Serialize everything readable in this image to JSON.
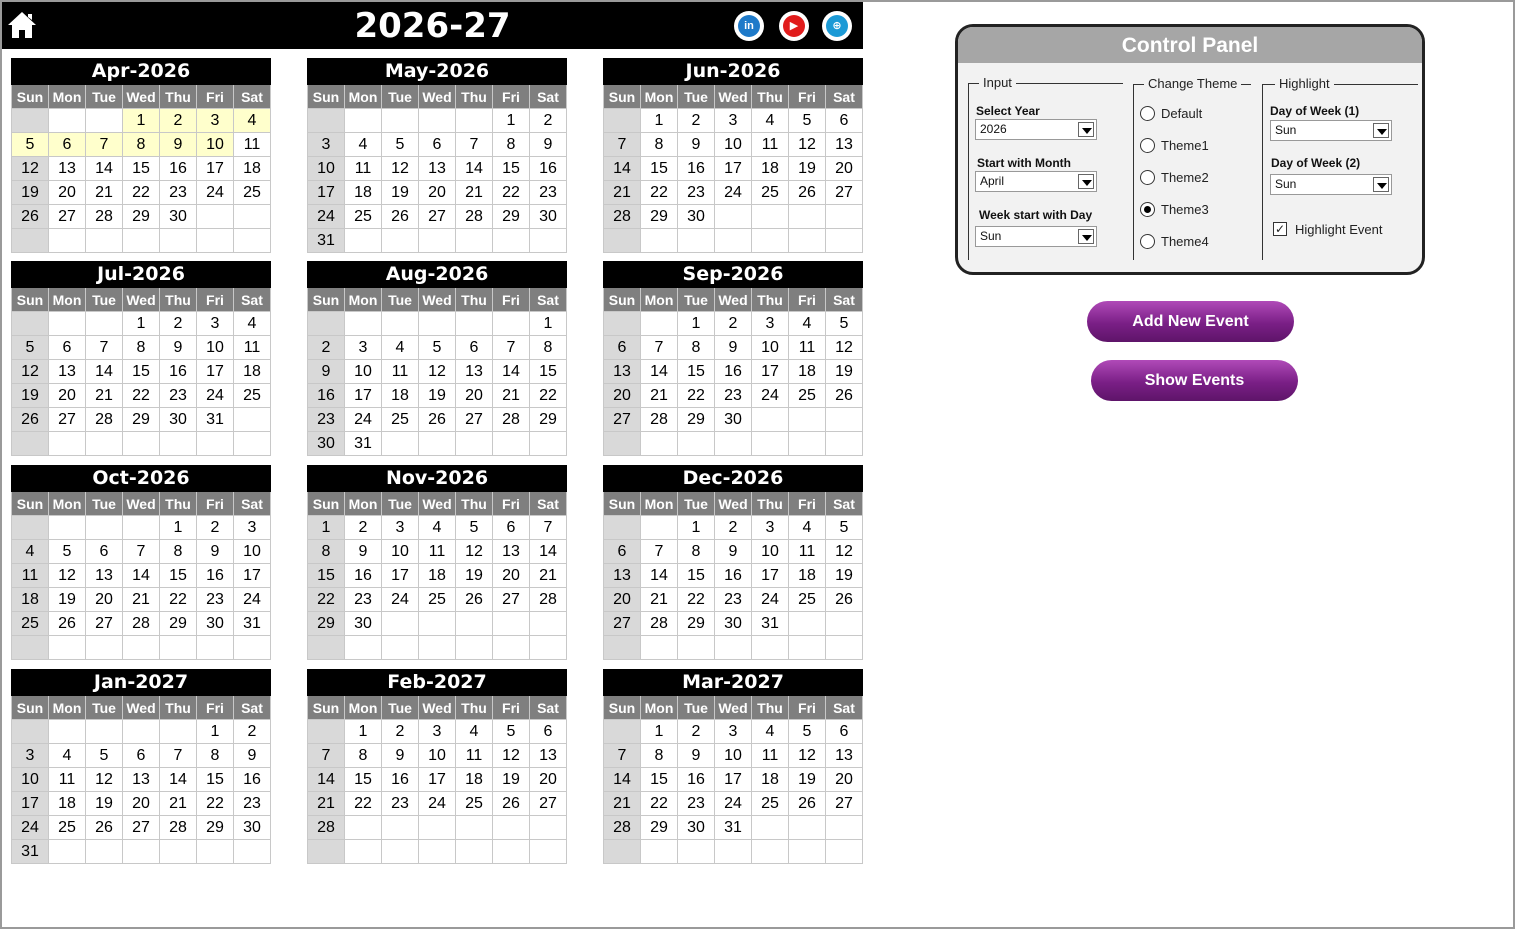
{
  "header": {
    "title": "2026-27",
    "social": [
      {
        "icon": "linkedin-icon",
        "glyph": "in",
        "color": "#1e7ac9"
      },
      {
        "icon": "youtube-icon",
        "glyph": "▶",
        "color": "#e11c1c"
      },
      {
        "icon": "globe-icon",
        "glyph": "⊕",
        "color": "#1c9ad6"
      }
    ]
  },
  "weekdays": [
    "Sun",
    "Mon",
    "Tue",
    "Wed",
    "Thu",
    "Fri",
    "Sat"
  ],
  "months": [
    {
      "title": "Apr-2026",
      "start": 3,
      "days": 30,
      "highlight": [
        1,
        2,
        3,
        4,
        5,
        6,
        7,
        8,
        9,
        10
      ]
    },
    {
      "title": "May-2026",
      "start": 5,
      "days": 31,
      "highlight": []
    },
    {
      "title": "Jun-2026",
      "start": 1,
      "days": 30,
      "highlight": []
    },
    {
      "title": "Jul-2026",
      "start": 3,
      "days": 31,
      "highlight": []
    },
    {
      "title": "Aug-2026",
      "start": 6,
      "days": 31,
      "highlight": []
    },
    {
      "title": "Sep-2026",
      "start": 2,
      "days": 30,
      "highlight": []
    },
    {
      "title": "Oct-2026",
      "start": 4,
      "days": 31,
      "highlight": []
    },
    {
      "title": "Nov-2026",
      "start": 0,
      "days": 30,
      "highlight": []
    },
    {
      "title": "Dec-2026",
      "start": 2,
      "days": 31,
      "highlight": []
    },
    {
      "title": "Jan-2027",
      "start": 5,
      "days": 31,
      "highlight": []
    },
    {
      "title": "Feb-2027",
      "start": 1,
      "days": 28,
      "highlight": []
    },
    {
      "title": "Mar-2027",
      "start": 1,
      "days": 31,
      "highlight": []
    }
  ],
  "control_panel": {
    "title": "Control Panel",
    "input": {
      "group_label": "Input",
      "year_label": "Select Year",
      "year_value": "2026",
      "month_label": "Start with Month",
      "month_value": "April",
      "weekstart_label": "Week start with Day",
      "weekstart_value": "Sun"
    },
    "theme": {
      "group_label": "Change Theme",
      "options": [
        "Default",
        "Theme1",
        "Theme2",
        "Theme3",
        "Theme4"
      ],
      "selected": "Theme3"
    },
    "highlight": {
      "group_label": "Highlight",
      "dow1_label": "Day of Week (1)",
      "dow1_value": "Sun",
      "dow2_label": "Day of Week (2)",
      "dow2_value": "Sun",
      "event_label": "Highlight  Event",
      "event_checked": true
    }
  },
  "buttons": {
    "add_event": "Add New Event",
    "show_events": "Show Events"
  },
  "colors": {
    "header_bg": "#000000",
    "weekday_header_bg": "#7f7f7f",
    "sunday_column_bg": "#d9d9d9",
    "highlight_bg": "#ffffcc",
    "button_purple": "#7a1f86",
    "panel_header_bg": "#a6a6a6"
  }
}
